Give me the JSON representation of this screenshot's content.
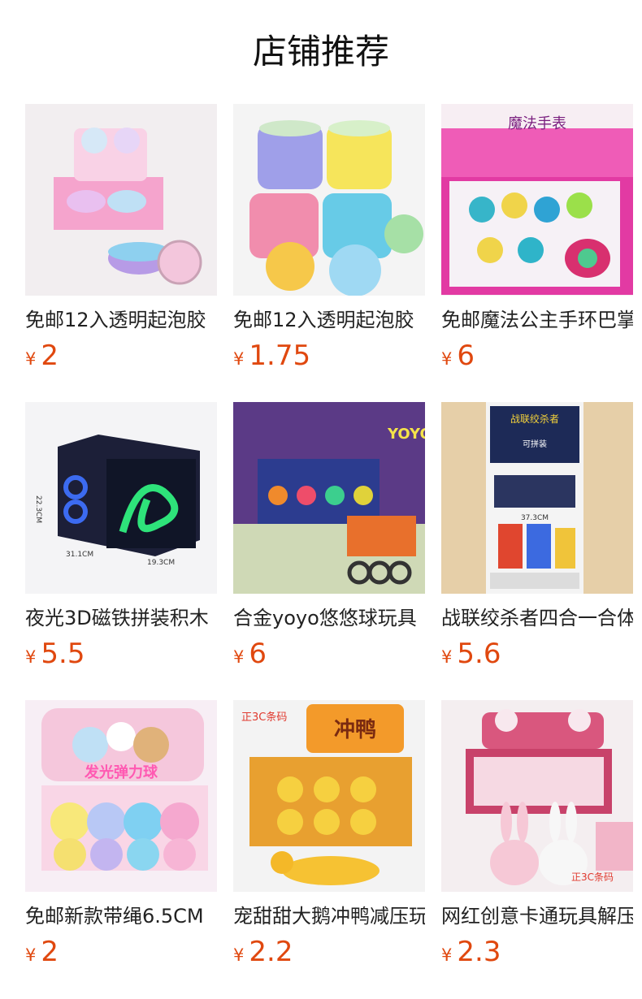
{
  "header": {
    "title": "店铺推荐"
  },
  "currency_symbol": "¥",
  "products": [
    {
      "name": "免邮12入透明起泡胶",
      "price": "2",
      "image_icon": "slime-box-image",
      "accent": "#f3a6d4"
    },
    {
      "name": "免邮12入透明起泡胶",
      "price": "1.75",
      "image_icon": "slime-jars-image",
      "accent": "#8fd7f5"
    },
    {
      "name": "免邮魔法公主手环巴掌",
      "price": "6",
      "image_icon": "princess-bracelet-image",
      "accent": "#e54fb0",
      "image_text": "魔法手表"
    },
    {
      "name": "夜光3D磁铁拼装积木",
      "price": "5.5",
      "image_icon": "magnetic-blocks-image",
      "accent": "#1b1f3a",
      "image_text": [
        "22.3CM",
        "31.1CM",
        "19.3CM"
      ]
    },
    {
      "name": "合金yoyo悠悠球玩具",
      "price": "6",
      "image_icon": "yoyo-toy-image",
      "accent": "#6b3f8f",
      "image_text": "YOYO"
    },
    {
      "name": "战联绞杀者四合一合体",
      "price": "5.6",
      "image_icon": "transformer-robot-image",
      "accent": "#d9a24a",
      "image_text": [
        "战联绞杀者",
        "可拼装",
        "37.3CM"
      ]
    },
    {
      "name": "免邮新款带绳6.5CM",
      "price": "2",
      "image_icon": "flash-ball-image",
      "accent": "#f7b7d0",
      "image_text": "发光弹力球"
    },
    {
      "name": "宠甜甜大鹅冲鸭减压玩具",
      "price": "2.2",
      "image_icon": "duck-squeeze-image",
      "accent": "#f2a12c",
      "image_text": [
        "正3C条码",
        "冲鸭"
      ]
    },
    {
      "name": "网红创意卡通玩具解压",
      "price": "2.3",
      "image_icon": "bunny-squeeze-image",
      "accent": "#d9577e",
      "image_text": "正3C条码"
    }
  ]
}
